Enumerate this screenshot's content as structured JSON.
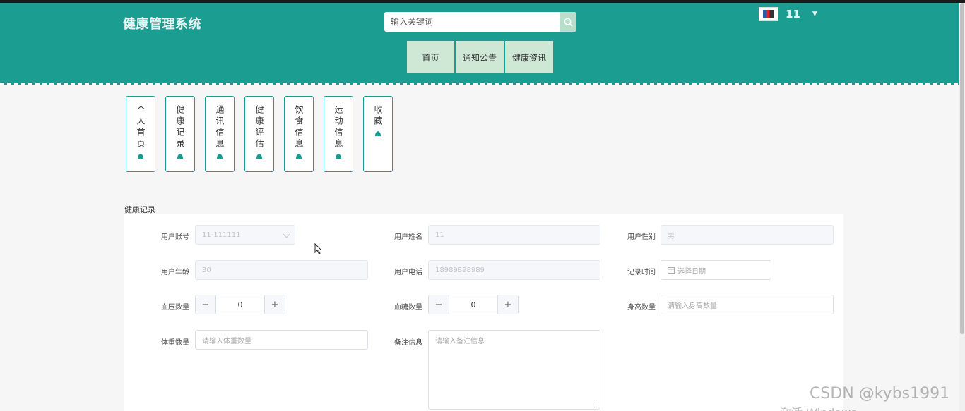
{
  "header": {
    "brand": "健康管理系统",
    "search_placeholder": "输入关键词",
    "username": "11",
    "nav": [
      "首页",
      "通知公告",
      "健康资讯"
    ]
  },
  "cards": [
    "个人首页",
    "健康记录",
    "通讯信息",
    "健康评估",
    "饮食信息",
    "运动信息",
    "收藏"
  ],
  "form": {
    "title": "健康记录",
    "account_label": "用户账号",
    "account_value": "11-111111",
    "name_label": "用户姓名",
    "name_value": "11",
    "gender_label": "用户性别",
    "gender_value": "男",
    "age_label": "用户年龄",
    "age_value": "30",
    "phone_label": "用户电话",
    "phone_value": "18989898989",
    "time_label": "记录时间",
    "time_placeholder": "选择日期",
    "bp_label": "血压数量",
    "bp_value": "0",
    "sugar_label": "血糖数量",
    "sugar_value": "0",
    "height_label": "身高数量",
    "height_placeholder": "请输入身高数量",
    "weight_label": "体重数量",
    "weight_placeholder": "请输入体重数量",
    "remark_label": "备注信息",
    "remark_placeholder": "请输入备注信息"
  },
  "overlay": {
    "watermark": "CSDN @kybs1991",
    "windows": "激活 Windows"
  },
  "colors": {
    "header": "#1b9d91",
    "nav_bg": "#cfe8d6",
    "accent": "#1b9d91"
  }
}
